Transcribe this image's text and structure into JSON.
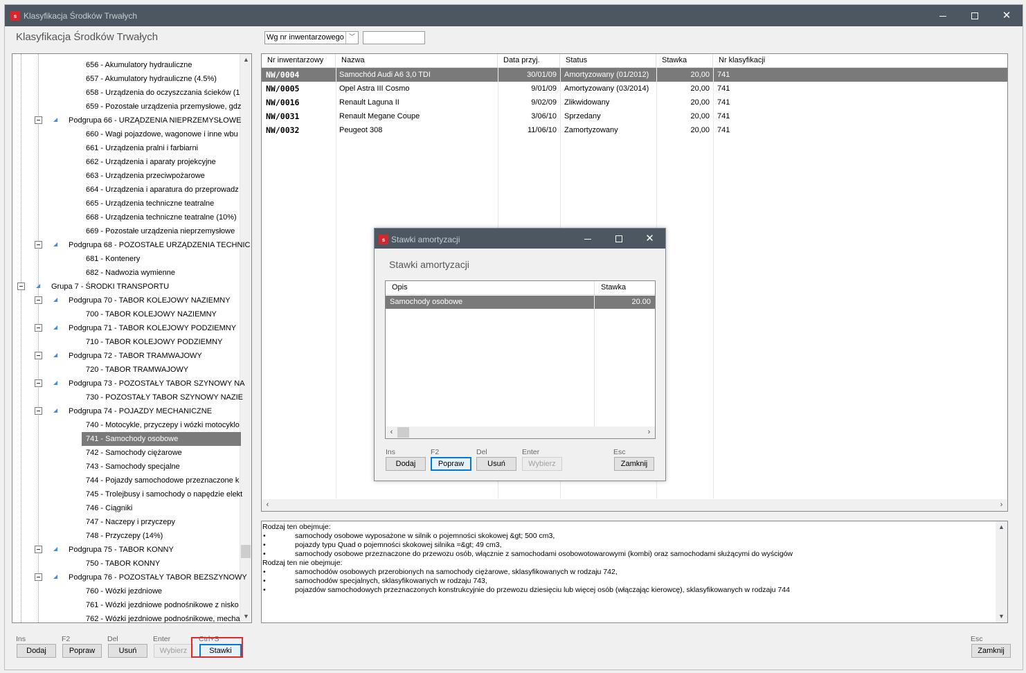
{
  "window": {
    "title": "Klasyfikacja Środków Trwałych",
    "app_icon": "s"
  },
  "heading": "Klasyfikacja Środków Trwałych",
  "sort_select": {
    "value": "Wg nr inwentarzowego"
  },
  "search": {
    "value": ""
  },
  "tree": {
    "nodes": [
      {
        "label": "656 - Akumulatory hydrauliczne",
        "level": 3
      },
      {
        "label": "657 - Akumulatory hydrauliczne (4.5%)",
        "level": 3
      },
      {
        "label": "658 - Urządzenia do oczyszczania ścieków (1",
        "level": 3
      },
      {
        "label": "659 - Pozostałe urządzenia przemysłowe, gdz",
        "level": 3
      },
      {
        "label": "Podgrupa 66 - URZĄDZENIA NIEPRZEMYSŁOWE",
        "level": 2
      },
      {
        "label": "660 - Wagi pojazdowe, wagonowe i inne wbu",
        "level": 3
      },
      {
        "label": "661 - Urządzenia pralni i farbiarni",
        "level": 3
      },
      {
        "label": "662 - Urządzenia i aparaty projekcyjne",
        "level": 3
      },
      {
        "label": "663 - Urządzenia przeciwpożarowe",
        "level": 3
      },
      {
        "label": "664 - Urządzenia i aparatura do przeprowadz",
        "level": 3
      },
      {
        "label": "665 - Urządzenia techniczne teatralne",
        "level": 3
      },
      {
        "label": "668 - Urządzenia techniczne teatralne (10%)",
        "level": 3
      },
      {
        "label": "669 - Pozostałe urządzenia nieprzemysłowe",
        "level": 3
      },
      {
        "label": "Podgrupa 68 - POZOSTAŁE URZĄDZENIA TECHNIC",
        "level": 2
      },
      {
        "label": "681 - Kontenery",
        "level": 3
      },
      {
        "label": "682 - Nadwozia wymienne",
        "level": 3
      },
      {
        "label": "Grupa 7 - ŚRODKI TRANSPORTU",
        "level": 1
      },
      {
        "label": "Podgrupa 70 - TABOR KOLEJOWY NAZIEMNY",
        "level": 2
      },
      {
        "label": "700 - TABOR KOLEJOWY NAZIEMNY",
        "level": 3
      },
      {
        "label": "Podgrupa 71 - TABOR KOLEJOWY PODZIEMNY",
        "level": 2
      },
      {
        "label": "710 - TABOR KOLEJOWY PODZIEMNY",
        "level": 3
      },
      {
        "label": "Podgrupa 72 - TABOR TRAMWAJOWY",
        "level": 2
      },
      {
        "label": "720 - TABOR TRAMWAJOWY",
        "level": 3
      },
      {
        "label": "Podgrupa 73 - POZOSTAŁY TABOR SZYNOWY NA",
        "level": 2
      },
      {
        "label": "730 - POZOSTAŁY TABOR SZYNOWY NAZIE",
        "level": 3
      },
      {
        "label": "Podgrupa 74 - POJAZDY MECHANICZNE",
        "level": 2
      },
      {
        "label": "740 - Motocykle, przyczepy i wózki motocyklo",
        "level": 3
      },
      {
        "label": "741 - Samochody osobowe",
        "level": 3,
        "selected": true
      },
      {
        "label": "742 - Samochody ciężarowe",
        "level": 3
      },
      {
        "label": "743 - Samochody specjalne",
        "level": 3
      },
      {
        "label": "744 - Pojazdy samochodowe przeznaczone k",
        "level": 3
      },
      {
        "label": "745 - Trolejbusy i samochody o napędzie elekt",
        "level": 3
      },
      {
        "label": "746 - Ciągniki",
        "level": 3
      },
      {
        "label": "747 - Naczepy i przyczepy",
        "level": 3
      },
      {
        "label": "748 - Przyczepy (14%)",
        "level": 3
      },
      {
        "label": "Podgrupa 75 - TABOR KONNY",
        "level": 2
      },
      {
        "label": "750 - TABOR KONNY",
        "level": 3
      },
      {
        "label": "Podgrupa 76 - POZOSTAŁY TABOR BEZSZYNOWY",
        "level": 2
      },
      {
        "label": "760 - Wózki jezdniowe",
        "level": 3
      },
      {
        "label": "761 - Wózki jezdniowe podnośnikowe z nisko",
        "level": 3
      },
      {
        "label": "762 - Wózki jezdniowe podnośnikowe, mecha",
        "level": 3
      }
    ]
  },
  "grid": {
    "columns": [
      "Nr inwentarzowy",
      "Nazwa",
      "Data przyj.",
      "Status",
      "Stawka",
      "Nr klasyfikacji"
    ],
    "rows": [
      {
        "inv": "NW/0004",
        "name": "Samochód Audi A6 3,0 TDI",
        "date": "30/01/09",
        "status": "Amortyzowany (01/2012)",
        "rate": "20,00",
        "class": "741",
        "selected": true
      },
      {
        "inv": "NW/0005",
        "name": "Opel Astra III Cosmo",
        "date": "9/01/09",
        "status": "Amortyzowany (03/2014)",
        "rate": "20,00",
        "class": "741"
      },
      {
        "inv": "NW/0016",
        "name": "Renault Laguna II",
        "date": "9/02/09",
        "status": "Zlikwidowany",
        "rate": "20,00",
        "class": "741"
      },
      {
        "inv": "NW/0031",
        "name": "Renault Megane Coupe",
        "date": "3/06/10",
        "status": "Sprzedany",
        "rate": "20,00",
        "class": "741"
      },
      {
        "inv": "NW/0032",
        "name": "Peugeot 308",
        "date": "11/06/10",
        "status": "Zamortyzowany",
        "rate": "20,00",
        "class": "741"
      }
    ]
  },
  "description": {
    "lines": [
      {
        "bullet": "",
        "text": "Rodzaj ten obejmuje:"
      },
      {
        "bullet": "•",
        "text": "samochody osobowe wyposażone w silnik o pojemności skokowej &gt; 500 cm3,"
      },
      {
        "bullet": "•",
        "text": "pojazdy typu Quad o pojemności skokowej silnika =&gt; 49 cm3,"
      },
      {
        "bullet": "•",
        "text": "samochody osobowe przeznaczone do przewozu osób, włącznie z samochodami osobowotowarowymi (kombi) oraz samochodami służącymi do wyścigów"
      },
      {
        "bullet": "",
        "text": "Rodzaj ten nie obejmuje:"
      },
      {
        "bullet": "•",
        "text": "samochodów osobowych przerobionych na samochody ciężarowe, sklasyfikowanych w rodzaju 742,"
      },
      {
        "bullet": "•",
        "text": "samochodów specjalnych, sklasyfikowanych w rodzaju 743,"
      },
      {
        "bullet": "•",
        "text": "pojazdów samochodowych przeznaczonych konstrukcyjnie do przewozu dziesięciu lub więcej osób (włączając kierowcę), sklasyfikowanych w rodzaju 744"
      }
    ]
  },
  "toolbar": {
    "add": {
      "hint": "Ins",
      "label": "Dodaj"
    },
    "edit": {
      "hint": "F2",
      "label": "Popraw"
    },
    "delete": {
      "hint": "Del",
      "label": "Usuń"
    },
    "choose": {
      "hint": "Enter",
      "label": "Wybierz"
    },
    "rates": {
      "hint": "Ctrl+S",
      "label": "Stawki"
    },
    "close": {
      "hint": "Esc",
      "label": "Zamknij"
    }
  },
  "dialog": {
    "title": "Stawki amortyzacji",
    "heading": "Stawki amortyzacji",
    "columns": [
      "Opis",
      "Stawka"
    ],
    "rows": [
      {
        "desc": "Samochody osobowe",
        "rate": "20.00"
      }
    ],
    "buttons": {
      "add": {
        "hint": "Ins",
        "label": "Dodaj"
      },
      "edit": {
        "hint": "F2",
        "label": "Popraw"
      },
      "delete": {
        "hint": "Del",
        "label": "Usuń"
      },
      "choose": {
        "hint": "Enter",
        "label": "Wybierz"
      },
      "close": {
        "hint": "Esc",
        "label": "Zamknij"
      }
    }
  },
  "colors": {
    "titlebar": "#4d5761",
    "selection": "#7a7a7a",
    "highlight_box": "#e32929",
    "app_icon": "#d9262d"
  }
}
